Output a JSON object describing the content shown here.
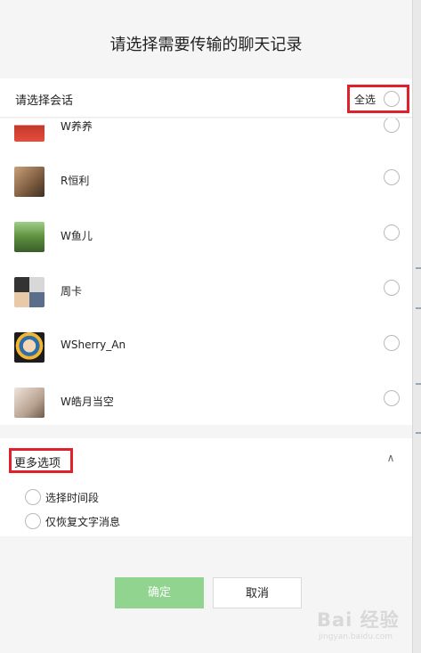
{
  "dialog": {
    "title": "请选择需要传输的聊天记录"
  },
  "section": {
    "label": "请选择会话",
    "select_all": "全选"
  },
  "conversations": [
    {
      "name": "W养养",
      "avatar": "avatar-yangyang"
    },
    {
      "name": "R恒利",
      "avatar": "avatar-hengli"
    },
    {
      "name": "W鱼儿",
      "avatar": "avatar-yuer"
    },
    {
      "name": "周卡",
      "avatar": "avatar-zhouka"
    },
    {
      "name": "WSherry_An",
      "avatar": "avatar-sherry"
    },
    {
      "name": "W皓月当空",
      "avatar": "avatar-haoyue"
    }
  ],
  "more_options": {
    "title": "更多选项",
    "chevron_icon": "chevron-up-icon",
    "options": [
      "选择时间段",
      "仅恢复文字消息"
    ]
  },
  "buttons": {
    "confirm": "确定",
    "cancel": "取消"
  },
  "watermark": {
    "main": "Bai 经验",
    "sub": "jingyan.baidu.com"
  },
  "colors": {
    "highlight": "#e0202a",
    "confirm_button": "#90d490"
  }
}
